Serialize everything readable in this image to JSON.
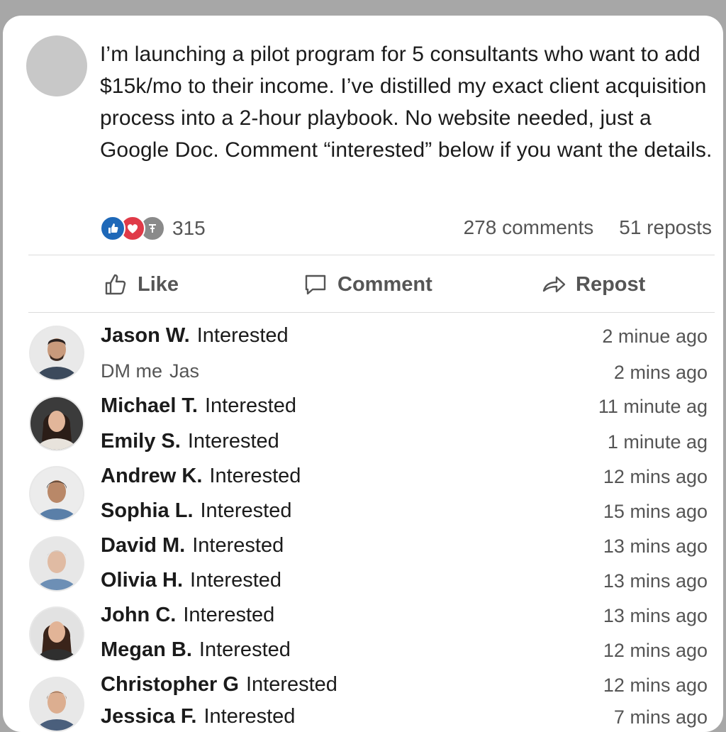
{
  "post": {
    "text": "I’m launching a pilot program for 5 consultants who want to add $15k/mo to their income. I’ve distilled my exact client acquisition process into a 2-hour playbook. No website needed, just a Google Doc. Comment “interested” below if you want the details.",
    "reaction_count": "315",
    "comments_count": "278 comments",
    "reposts_count": "51 reposts",
    "reaction_icons": [
      "like-icon",
      "love-icon",
      "insightful-icon"
    ]
  },
  "actions": {
    "like": "Like",
    "comment": "Comment",
    "repost": "Repost"
  },
  "comments": [
    {
      "name": "Jason W.",
      "text": "Interested",
      "time": "2 minue ago"
    },
    {
      "name": "DM me",
      "text": "Jas",
      "time": "2 mins ago"
    },
    {
      "name": "Michael T.",
      "text": "Interested",
      "time": "11 minute ag"
    },
    {
      "name": "Emily S.",
      "text": "Interested",
      "time": "1 minute ag"
    },
    {
      "name": "Andrew K.",
      "text": "Interested",
      "time": "12 mins  ago"
    },
    {
      "name": "Sophia L.",
      "text": "Interested",
      "time": "15 mins  ago"
    },
    {
      "name": "David M.",
      "text": "Interested",
      "time": "13 mins  ago"
    },
    {
      "name": "Olivia H.",
      "text": "Interested",
      "time": "13 mins  ago"
    },
    {
      "name": "John C.",
      "text": "Interested",
      "time": "13 mins  ago"
    },
    {
      "name": "Megan B.",
      "text": "Interested",
      "time": "12 mins  ago"
    },
    {
      "name": "Christopher G",
      "text": "Interested",
      "time": "12 mins  ago"
    },
    {
      "name": "Jessica F.",
      "text": "Interested",
      "time": "7 mins  ago"
    }
  ],
  "colors": {
    "like_blue": "#1e68b8",
    "love_red": "#e03a48",
    "muted_text": "#555555"
  }
}
